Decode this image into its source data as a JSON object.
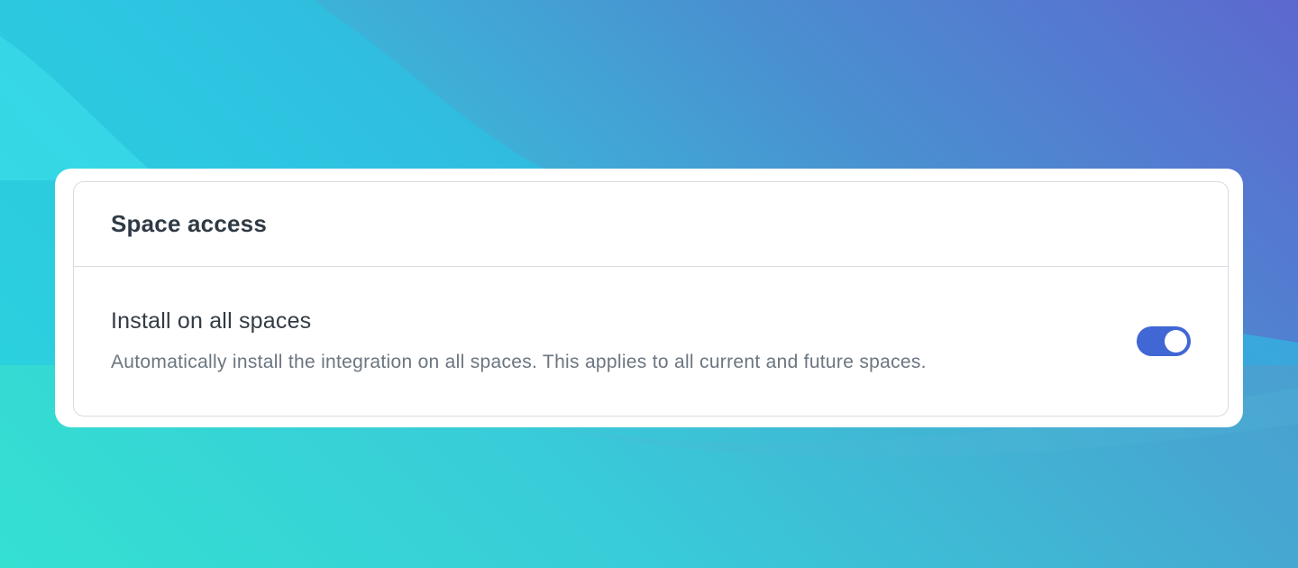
{
  "background": {
    "gradient_colors": [
      "#2fe6cf",
      "#35c6dc",
      "#4a8fd0",
      "#5d68cf"
    ]
  },
  "card": {
    "title": "Space access",
    "setting": {
      "label": "Install on all spaces",
      "description": "Automatically install the integration on all spaces. This applies to all current and future spaces.",
      "toggle_state": "on",
      "toggle_color": "#4067d4"
    }
  }
}
